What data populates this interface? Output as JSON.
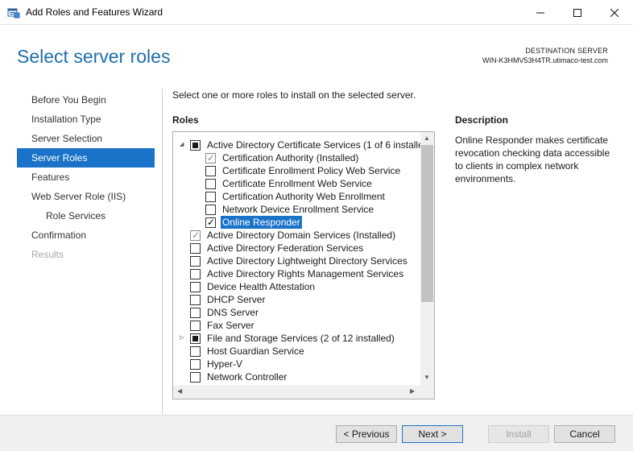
{
  "window": {
    "title": "Add Roles and Features Wizard",
    "minimize_glyph": "—",
    "maximize_glyph": "☐",
    "close_glyph": "✕"
  },
  "header": {
    "page_title": "Select server roles",
    "destination_label": "DESTINATION SERVER",
    "destination_server": "WIN-K3HMV53H4TR.utimaco-test.com"
  },
  "nav": {
    "items": [
      {
        "label": "Before You Begin",
        "state": "normal"
      },
      {
        "label": "Installation Type",
        "state": "normal"
      },
      {
        "label": "Server Selection",
        "state": "normal"
      },
      {
        "label": "Server Roles",
        "state": "active"
      },
      {
        "label": "Features",
        "state": "normal"
      },
      {
        "label": "Web Server Role (IIS)",
        "state": "normal"
      },
      {
        "label": "Role Services",
        "state": "sub"
      },
      {
        "label": "Confirmation",
        "state": "normal"
      },
      {
        "label": "Results",
        "state": "disabled"
      }
    ]
  },
  "main": {
    "intro": "Select one or more roles to install on the selected server.",
    "roles_heading": "Roles",
    "description_heading": "Description",
    "description_text": "Online Responder makes certificate revocation checking data accessible to clients in complex network environments.",
    "roles": [
      {
        "label": "Active Directory Certificate Services (1 of 6 installe",
        "level": 0,
        "expander": "expanded",
        "state": "partial",
        "selected": false
      },
      {
        "label": "Certification Authority (Installed)",
        "level": 1,
        "expander": "none",
        "state": "installed",
        "selected": false
      },
      {
        "label": "Certificate Enrollment Policy Web Service",
        "level": 1,
        "expander": "none",
        "state": "unchecked",
        "selected": false
      },
      {
        "label": "Certificate Enrollment Web Service",
        "level": 1,
        "expander": "none",
        "state": "unchecked",
        "selected": false
      },
      {
        "label": "Certification Authority Web Enrollment",
        "level": 1,
        "expander": "none",
        "state": "unchecked",
        "selected": false
      },
      {
        "label": "Network Device Enrollment Service",
        "level": 1,
        "expander": "none",
        "state": "unchecked",
        "selected": false
      },
      {
        "label": "Online Responder",
        "level": 1,
        "expander": "none",
        "state": "checked",
        "selected": true
      },
      {
        "label": "Active Directory Domain Services (Installed)",
        "level": 0,
        "expander": "none",
        "state": "installed",
        "selected": false
      },
      {
        "label": "Active Directory Federation Services",
        "level": 0,
        "expander": "none",
        "state": "unchecked",
        "selected": false
      },
      {
        "label": "Active Directory Lightweight Directory Services",
        "level": 0,
        "expander": "none",
        "state": "unchecked",
        "selected": false
      },
      {
        "label": "Active Directory Rights Management Services",
        "level": 0,
        "expander": "none",
        "state": "unchecked",
        "selected": false
      },
      {
        "label": "Device Health Attestation",
        "level": 0,
        "expander": "none",
        "state": "unchecked",
        "selected": false
      },
      {
        "label": "DHCP Server",
        "level": 0,
        "expander": "none",
        "state": "unchecked",
        "selected": false
      },
      {
        "label": "DNS Server",
        "level": 0,
        "expander": "none",
        "state": "unchecked",
        "selected": false
      },
      {
        "label": "Fax Server",
        "level": 0,
        "expander": "none",
        "state": "unchecked",
        "selected": false
      },
      {
        "label": "File and Storage Services (2 of 12 installed)",
        "level": 0,
        "expander": "collapsed",
        "state": "partial",
        "selected": false
      },
      {
        "label": "Host Guardian Service",
        "level": 0,
        "expander": "none",
        "state": "unchecked",
        "selected": false
      },
      {
        "label": "Hyper-V",
        "level": 0,
        "expander": "none",
        "state": "unchecked",
        "selected": false
      },
      {
        "label": "Network Controller",
        "level": 0,
        "expander": "none",
        "state": "unchecked",
        "selected": false
      }
    ]
  },
  "footer": {
    "previous_label": "< Previous",
    "next_label": "Next >",
    "install_label": "Install",
    "cancel_label": "Cancel"
  },
  "colors": {
    "title_blue": "#1e6fa8",
    "selection_blue": "#1a73c8",
    "footer_bg": "#f0f0f0"
  }
}
